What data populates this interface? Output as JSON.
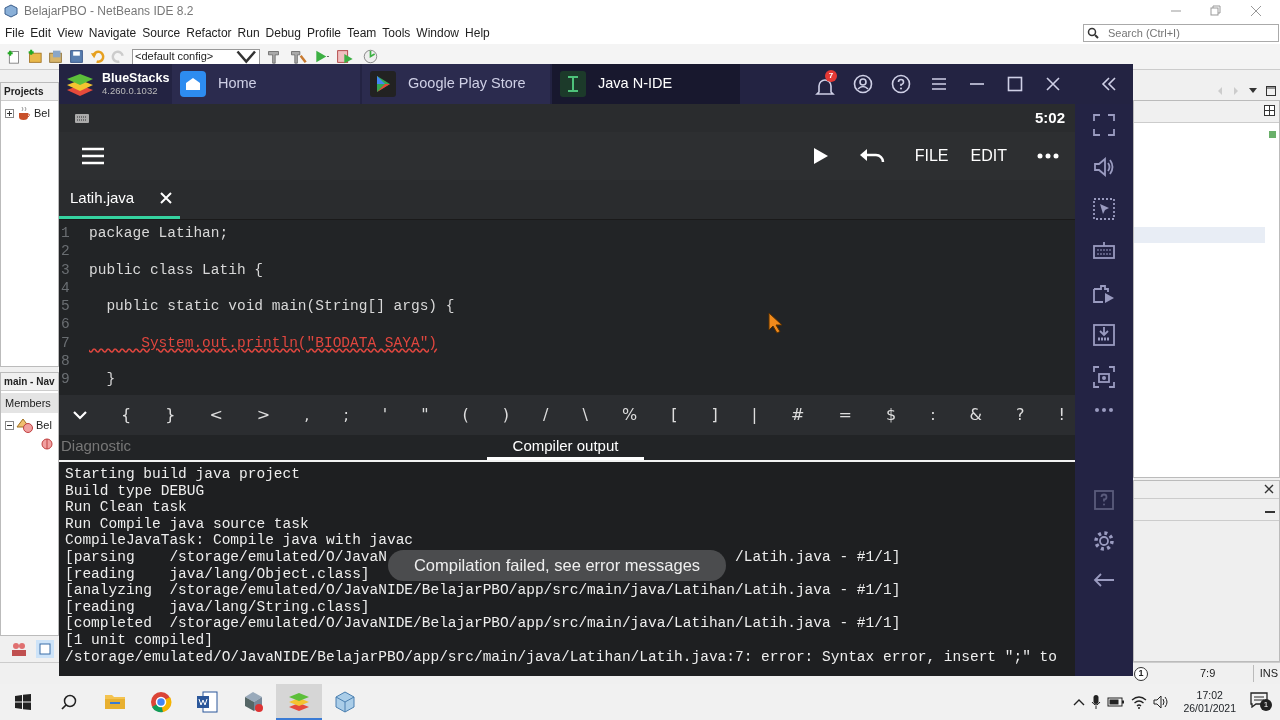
{
  "netbeans": {
    "title": "BelajarPBO - NetBeans IDE 8.2",
    "menu": [
      "File",
      "Edit",
      "View",
      "Navigate",
      "Source",
      "Refactor",
      "Run",
      "Debug",
      "Profile",
      "Team",
      "Tools",
      "Window",
      "Help"
    ],
    "config": "<default config>",
    "search": {
      "placeholder": "Search (Ctrl+I)"
    },
    "projects": {
      "title": "Projects",
      "tree": [
        {
          "label": "Bel",
          "expanded": false
        }
      ]
    },
    "navigator": {
      "title": "main - Nav",
      "header": "Members",
      "tree": [
        {
          "label": "Bel",
          "expanded": true
        }
      ]
    },
    "status": {
      "notifications": "1",
      "position": "7:9",
      "mode": "INS"
    }
  },
  "bluestacks": {
    "brand": "BlueStacks",
    "version": "4.260.0.1032",
    "notification_count": "7",
    "tabs": [
      {
        "label": "Home",
        "kind": "home",
        "selected": false
      },
      {
        "label": "Google Play Store",
        "kind": "store",
        "selected": false
      },
      {
        "label": "Java N-IDE",
        "kind": "ide",
        "selected": true
      }
    ]
  },
  "android": {
    "clock": "5:02",
    "actions": [
      "FILE",
      "EDIT"
    ],
    "file_tabs": [
      {
        "label": "Latih.java",
        "selected": true
      }
    ],
    "code_lines": [
      {
        "number": "1",
        "text": "package Latihan;",
        "error": false
      },
      {
        "number": "2"
      },
      {
        "number": "3",
        "text": "public class Latih {",
        "error": false
      },
      {
        "number": "4"
      },
      {
        "number": "5",
        "text": "  public static void main(String[] args) {",
        "error": false
      },
      {
        "number": "6"
      },
      {
        "number": "7",
        "text": "      System.out.println(\"BIODATA SAYA\")",
        "error": true
      },
      {
        "number": "8"
      },
      {
        "number": "9",
        "text": "  }",
        "error": false
      }
    ],
    "symbols": [
      "{",
      "}",
      "<",
      ">",
      ",",
      ";",
      "'",
      "\"",
      "(",
      ")",
      "/",
      "\\",
      "%",
      "[",
      "]",
      "|",
      "#",
      "=",
      "$",
      ":",
      "&",
      "?",
      "!"
    ],
    "output_tabs": [
      {
        "label": "Diagnostic",
        "selected": false
      },
      {
        "label": "Compiler output",
        "selected": true
      }
    ],
    "output_lines": [
      {
        "text": "Starting build java project"
      },
      {
        "text": "Build type DEBUG"
      },
      {
        "text": "Run Clean task"
      },
      {
        "text": "Run Compile java source task"
      },
      {
        "text": "CompileJavaTask: Compile java with javac"
      },
      {
        "text": "[parsing    /storage/emulated/O/JavaN",
        "tail": "/Latih.java - #1/1]"
      },
      {
        "text": "[reading    java/lang/Object.class]"
      },
      {
        "text": "[analyzing  /storage/emulated/O/JavaNIDE/BelajarPBO/app/src/main/java/Latihan/Latih.java - #1/1]"
      },
      {
        "text": "[reading    java/lang/String.class]"
      },
      {
        "text": "[completed  /storage/emulated/O/JavaNIDE/BelajarPBO/app/src/main/java/Latihan/Latih.java - #1/1]"
      },
      {
        "text": "[1 unit compiled]"
      },
      {
        "text": "/storage/emulated/O/JavaNIDE/BelajarPBO/app/src/main/java/Latihan/Latih.java:7: error: Syntax error, insert \";\" to"
      }
    ],
    "toast": "Compilation failed, see error messages"
  },
  "taskbar": {
    "apps": [
      {
        "kind": "folder",
        "selected": false
      },
      {
        "kind": "browser",
        "selected": false
      },
      {
        "kind": "word",
        "selected": false
      },
      {
        "kind": "tool",
        "selected": false
      },
      {
        "kind": "bluestacks",
        "selected": true
      },
      {
        "kind": "cube",
        "selected": false
      }
    ],
    "time": "17:02",
    "date": "26/01/2021",
    "notifications": "1"
  }
}
